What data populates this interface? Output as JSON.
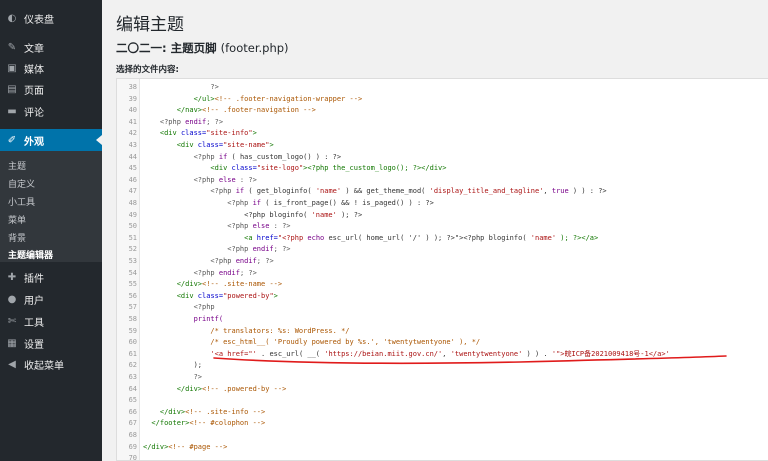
{
  "sidebar": {
    "items": [
      {
        "label": "仪表盘",
        "icon": "dashboard-icon",
        "glyph": "◐"
      },
      {
        "label": "文章",
        "icon": "pin-icon",
        "glyph": "✎"
      },
      {
        "label": "媒体",
        "icon": "media-icon",
        "glyph": "▣"
      },
      {
        "label": "页面",
        "icon": "page-icon",
        "glyph": "▤"
      },
      {
        "label": "评论",
        "icon": "comment-icon",
        "glyph": "▬"
      },
      {
        "label": "外观",
        "icon": "paintbrush-icon",
        "glyph": "✐",
        "active": true
      },
      {
        "label": "插件",
        "icon": "plugin-icon",
        "glyph": "✚"
      },
      {
        "label": "用户",
        "icon": "user-icon",
        "glyph": "●"
      },
      {
        "label": "工具",
        "icon": "wrench-icon",
        "glyph": "✄"
      },
      {
        "label": "设置",
        "icon": "settings-icon",
        "glyph": "▦"
      },
      {
        "label": "收起菜单",
        "icon": "collapse-icon",
        "glyph": "◀"
      }
    ],
    "submenu": [
      {
        "label": "主题"
      },
      {
        "label": "自定义"
      },
      {
        "label": "小工具"
      },
      {
        "label": "菜单"
      },
      {
        "label": "背景"
      },
      {
        "label": "主题编辑器",
        "current": true
      }
    ]
  },
  "main": {
    "page_title": "编辑主题",
    "file_title_prefix": "二〇二一: 主题页脚",
    "file_name": "(footer.php)",
    "choose_label": "选择的文件内容:"
  },
  "colors": {
    "sidebar_bg": "#23282d",
    "active_bg": "#0073aa",
    "annotation_red": "#e01b1b"
  },
  "editor": {
    "lines": [
      {
        "num": "38",
        "tokens": [
          {
            "t": "                ?>",
            "c": "meta"
          }
        ]
      },
      {
        "num": "39",
        "tokens": [
          {
            "t": "            </ul>",
            "c": "tag"
          },
          {
            "t": "<!-- .footer-navigation-wrapper -->",
            "c": "comment"
          }
        ]
      },
      {
        "num": "40",
        "tokens": [
          {
            "t": "        </nav>",
            "c": "tag"
          },
          {
            "t": "<!-- .footer-navigation -->",
            "c": "comment"
          }
        ]
      },
      {
        "num": "41",
        "tokens": [
          {
            "t": "    <?php ",
            "c": "meta"
          },
          {
            "t": "endif",
            "c": "keyword"
          },
          {
            "t": "; ?>",
            "c": "meta"
          }
        ]
      },
      {
        "num": "42",
        "tokens": [
          {
            "t": "    <div ",
            "c": "tag"
          },
          {
            "t": "class=",
            "c": "attr"
          },
          {
            "t": "\"site-info\"",
            "c": "string"
          },
          {
            "t": ">",
            "c": "tag"
          }
        ]
      },
      {
        "num": "43",
        "tokens": [
          {
            "t": "        <div ",
            "c": "tag"
          },
          {
            "t": "class=",
            "c": "attr"
          },
          {
            "t": "\"site-name\"",
            "c": "string"
          },
          {
            "t": ">",
            "c": "tag"
          }
        ]
      },
      {
        "num": "44",
        "tokens": [
          {
            "t": "            <?php ",
            "c": "meta"
          },
          {
            "t": "if",
            "c": "keyword"
          },
          {
            "t": " ( has_custom_logo() ) : ?>",
            "c": "plain"
          }
        ]
      },
      {
        "num": "45",
        "tokens": [
          {
            "t": "                <div ",
            "c": "tag"
          },
          {
            "t": "class=",
            "c": "attr"
          },
          {
            "t": "\"site-logo\"",
            "c": "string"
          },
          {
            "t": "><?php the_custom_logo(); ?></div>",
            "c": "tag"
          }
        ]
      },
      {
        "num": "46",
        "tokens": [
          {
            "t": "            <?php ",
            "c": "meta"
          },
          {
            "t": "else",
            "c": "keyword"
          },
          {
            "t": " : ?>",
            "c": "meta"
          }
        ]
      },
      {
        "num": "47",
        "tokens": [
          {
            "t": "                <?php ",
            "c": "meta"
          },
          {
            "t": "if",
            "c": "keyword"
          },
          {
            "t": " ( get_bloginfo( ",
            "c": "plain"
          },
          {
            "t": "'name'",
            "c": "string"
          },
          {
            "t": " ) && get_theme_mod( ",
            "c": "plain"
          },
          {
            "t": "'display_title_and_tagline'",
            "c": "string"
          },
          {
            "t": ", ",
            "c": "plain"
          },
          {
            "t": "true",
            "c": "keyword"
          },
          {
            "t": " ) ) : ?>",
            "c": "plain"
          }
        ]
      },
      {
        "num": "48",
        "tokens": [
          {
            "t": "                    <?php ",
            "c": "meta"
          },
          {
            "t": "if",
            "c": "keyword"
          },
          {
            "t": " ( is_front_page() && ! is_paged() ) : ?>",
            "c": "plain"
          }
        ]
      },
      {
        "num": "49",
        "tokens": [
          {
            "t": "                        <?php bloginfo( ",
            "c": "plain"
          },
          {
            "t": "'name'",
            "c": "string"
          },
          {
            "t": " ); ?>",
            "c": "plain"
          }
        ]
      },
      {
        "num": "50",
        "tokens": [
          {
            "t": "                    <?php ",
            "c": "meta"
          },
          {
            "t": "else",
            "c": "keyword"
          },
          {
            "t": " : ?>",
            "c": "meta"
          }
        ]
      },
      {
        "num": "51",
        "tokens": [
          {
            "t": "                        <a ",
            "c": "tag"
          },
          {
            "t": "href=",
            "c": "attr"
          },
          {
            "t": "\"<?php ",
            "c": "string"
          },
          {
            "t": "echo",
            "c": "keyword"
          },
          {
            "t": " esc_url( home_url( '/' ) ); ?>\"",
            "c": "plain"
          },
          {
            "t": "><?php bloginfo( ",
            "c": "plain"
          },
          {
            "t": "'name'",
            "c": "string"
          },
          {
            "t": " ); ?></a>",
            "c": "tag"
          }
        ]
      },
      {
        "num": "52",
        "tokens": [
          {
            "t": "                    <?php ",
            "c": "meta"
          },
          {
            "t": "endif",
            "c": "keyword"
          },
          {
            "t": "; ?>",
            "c": "meta"
          }
        ]
      },
      {
        "num": "53",
        "tokens": [
          {
            "t": "                <?php ",
            "c": "meta"
          },
          {
            "t": "endif",
            "c": "keyword"
          },
          {
            "t": "; ?>",
            "c": "meta"
          }
        ]
      },
      {
        "num": "54",
        "tokens": [
          {
            "t": "            <?php ",
            "c": "meta"
          },
          {
            "t": "endif",
            "c": "keyword"
          },
          {
            "t": "; ?>",
            "c": "meta"
          }
        ]
      },
      {
        "num": "55",
        "tokens": [
          {
            "t": "        </div>",
            "c": "tag"
          },
          {
            "t": "<!-- .site-name -->",
            "c": "comment"
          }
        ]
      },
      {
        "num": "56",
        "tokens": [
          {
            "t": "        <div ",
            "c": "tag"
          },
          {
            "t": "class=",
            "c": "attr"
          },
          {
            "t": "\"powered-by\"",
            "c": "string"
          },
          {
            "t": ">",
            "c": "tag"
          }
        ]
      },
      {
        "num": "57",
        "tokens": [
          {
            "t": "            <?php",
            "c": "meta"
          }
        ]
      },
      {
        "num": "58",
        "tokens": [
          {
            "t": "            printf(",
            "c": "keyword"
          }
        ]
      },
      {
        "num": "59",
        "tokens": [
          {
            "t": "                /* translators: %s: WordPress. */",
            "c": "comment"
          }
        ]
      },
      {
        "num": "60",
        "tokens": [
          {
            "t": "                /* esc_html__( 'Proudly powered by %s.', 'twentytwentyone' ), */",
            "c": "comment"
          }
        ]
      },
      {
        "num": "61",
        "tokens": [
          {
            "t": "                '<a href=\"'",
            "c": "string"
          },
          {
            "t": " . esc_url( __( ",
            "c": "plain"
          },
          {
            "t": "'https://beian.miit.gov.cn/'",
            "c": "string"
          },
          {
            "t": ", ",
            "c": "plain"
          },
          {
            "t": "'twentytwentyone'",
            "c": "string"
          },
          {
            "t": " ) ) . ",
            "c": "plain"
          },
          {
            "t": "'\">皖ICP备2021009418号-1</a>'",
            "c": "string"
          }
        ]
      },
      {
        "num": "62",
        "tokens": [
          {
            "t": "            );",
            "c": "plain"
          }
        ]
      },
      {
        "num": "63",
        "tokens": [
          {
            "t": "            ?>",
            "c": "meta"
          }
        ]
      },
      {
        "num": "64",
        "tokens": [
          {
            "t": "        </div>",
            "c": "tag"
          },
          {
            "t": "<!-- .powered-by -->",
            "c": "comment"
          }
        ]
      },
      {
        "num": "65",
        "tokens": [
          {
            "t": "",
            "c": "plain"
          }
        ]
      },
      {
        "num": "66",
        "tokens": [
          {
            "t": "    </div>",
            "c": "tag"
          },
          {
            "t": "<!-- .site-info -->",
            "c": "comment"
          }
        ]
      },
      {
        "num": "67",
        "tokens": [
          {
            "t": "  </footer>",
            "c": "tag"
          },
          {
            "t": "<!-- #colophon -->",
            "c": "comment"
          }
        ]
      },
      {
        "num": "68",
        "tokens": [
          {
            "t": "",
            "c": "plain"
          }
        ]
      },
      {
        "num": "69",
        "tokens": [
          {
            "t": "</div>",
            "c": "tag"
          },
          {
            "t": "<!-- #page -->",
            "c": "comment"
          }
        ]
      },
      {
        "num": "70",
        "tokens": [
          {
            "t": "",
            "c": "plain"
          }
        ]
      }
    ]
  }
}
